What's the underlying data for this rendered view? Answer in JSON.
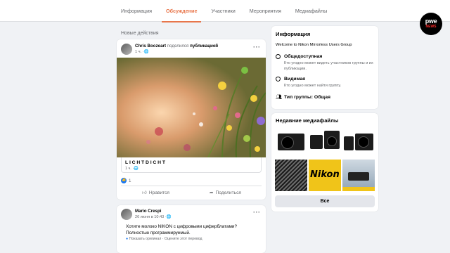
{
  "tabs": [
    {
      "label": "Информация",
      "active": false
    },
    {
      "label": "Обсуждение",
      "active": true
    },
    {
      "label": "Участники",
      "active": false
    },
    {
      "label": "Мероприятия",
      "active": false
    },
    {
      "label": "Медиафайлы",
      "active": false
    }
  ],
  "logo": {
    "line1": "pwe",
    "line2": "NEWS"
  },
  "feed": {
    "section_title": "Новые действия",
    "post1": {
      "author": "Chris Boozeart",
      "action": "поделился",
      "object": "публикацией",
      "time": "1 ч.",
      "shared_name": "LICHTDICHT",
      "shared_time": "1 ч.",
      "likes": "1",
      "like_label": "Нравится",
      "share_label": "Поделиться"
    },
    "post2": {
      "author": "Mario Crespi",
      "time": "26 июня в 10:43",
      "text": "Хотите молоко NIKON с цифровыми циферблатами? Полностью программируемый.",
      "translation": "Показать оригинал · Оцените этот перевод"
    }
  },
  "info": {
    "title": "Информация",
    "description": "Welcome to Nikon Mirrorless Users Group",
    "privacy_title": "Общедоступная",
    "privacy_desc": "Кто угодно может видеть участников группы и их публикации.",
    "visibility_title": "Видимая",
    "visibility_desc": "Кто угодно может найти группу.",
    "type_label": "Тип группы: Общая"
  },
  "media": {
    "title": "Недавние медиафайлы",
    "thumb_brand": "Nikon",
    "button": "Все"
  },
  "colors": {
    "accent": "#e8764b",
    "link": "#1877f2",
    "background": "#f0f2f5"
  }
}
